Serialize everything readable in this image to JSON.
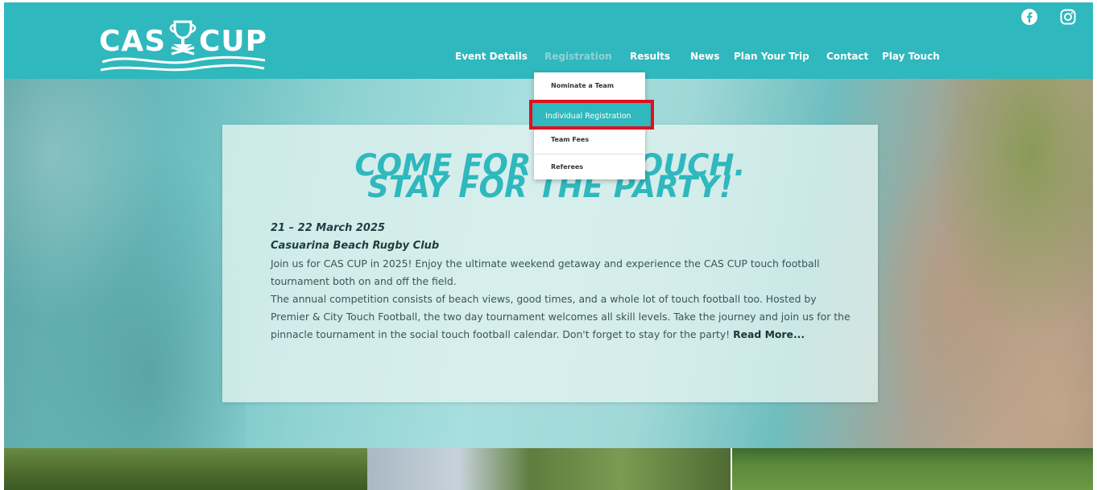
{
  "header": {
    "logo_left": "CAS",
    "logo_right": "CUP",
    "nav": [
      {
        "label": "Event Details"
      },
      {
        "label": "Registration"
      },
      {
        "label": "Results"
      },
      {
        "label": "News"
      },
      {
        "label": "Plan Your Trip"
      },
      {
        "label": "Contact"
      },
      {
        "label": "Play Touch"
      }
    ]
  },
  "dropdown": {
    "items": [
      {
        "label": "Nominate a Team"
      },
      {
        "label": "Individual Registration"
      },
      {
        "label": "Team Fees"
      },
      {
        "label": "Referees"
      }
    ],
    "highlighted_index": 1
  },
  "hero": {
    "headline_line1": "COME FOR THE TOUCH.",
    "headline_line2": "STAY FOR THE PARTY!",
    "date": "21 – 22 March 2025",
    "venue": "Casuarina Beach Rugby Club",
    "para1": "Join us for CAS CUP in 2025! Enjoy the ultimate weekend getaway and experience the CAS CUP touch football tournament both on and off the field.",
    "para2": "The annual competition consists of beach views, good times, and a whole lot of touch football too. Hosted by Premier & City Touch Football, the two day tournament welcomes all skill levels. Take the journey and join us for the pinnacle tournament in the social touch football calendar. Don't forget to stay for the party!",
    "read_more": "Read More..."
  },
  "colors": {
    "brand_teal": "#2fb8bd",
    "highlight_red": "#e0101c"
  },
  "icons": {
    "social": [
      "facebook-icon",
      "instagram-icon"
    ],
    "logo": [
      "trophy-icon",
      "waves-icon"
    ]
  }
}
